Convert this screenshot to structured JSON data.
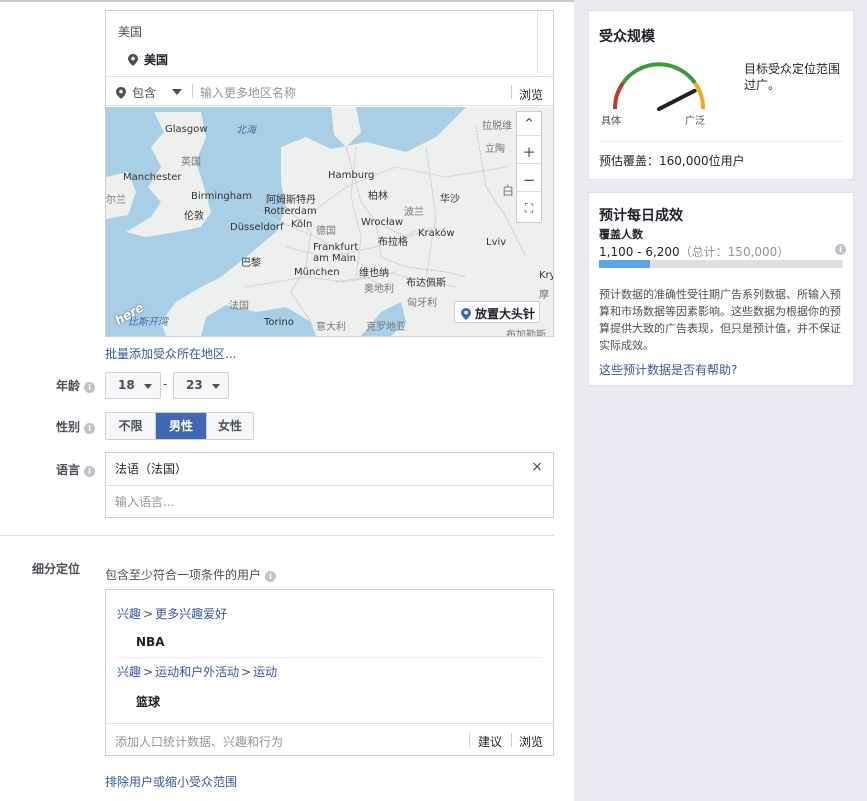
{
  "location": {
    "country_header": "美国",
    "selected": "美国",
    "include_label": "包含",
    "input_placeholder": "输入更多地区名称",
    "browse_label": "浏览",
    "drop_pin_label": "放置大头针",
    "bulk_add_link": "批量添加受众所在地区...",
    "map": {
      "provider_logo": "here",
      "labels": {
        "glasgow": "Glasgow",
        "north_sea": "北海",
        "uk": "英国",
        "manchester": "Manchester",
        "birmingham": "Birmingham",
        "london": "伦敦",
        "ireland": "尔兰",
        "amsterdam": "阿姆斯特丹",
        "rotterdam": "Rotterdam",
        "dusseldorf": "Düsseldorf",
        "koln": "Köln",
        "hamburg": "Hamburg",
        "berlin": "柏林",
        "germany": "德国",
        "frankfurt": "Frankfurt am Main",
        "paris": "巴黎",
        "munchen": "München",
        "france": "法国",
        "vienna": "维也纳",
        "wroclaw": "Wrocław",
        "poland": "波兰",
        "warsaw": "华沙",
        "prague": "布拉格",
        "krakow": "Kraków",
        "lviv": "Lviv",
        "budapest": "布达佩斯",
        "hungary": "匈牙利",
        "austria": "奥地利",
        "torino": "Torino",
        "italy": "意大利",
        "croatia": "克罗地亚",
        "bosnia": "布加勒斯",
        "biscay": "比斯开湾",
        "latvia": "拉脱维",
        "lithuania": "立陶",
        "belarus": "白",
        "kryvyi": "Kry",
        "moldova": "摩"
      }
    }
  },
  "age": {
    "label": "年龄",
    "min": "18",
    "max": "23",
    "separator": "-"
  },
  "gender": {
    "label": "性别",
    "options": [
      "不限",
      "男性",
      "女性"
    ],
    "selected": "男性"
  },
  "language": {
    "label": "语言",
    "selected_tag": "法语（法国）",
    "input_placeholder": "输入语言..."
  },
  "detailed_targeting": {
    "label": "细分定位",
    "description": "包含至少符合一项条件的用户",
    "groups": [
      {
        "path": [
          "兴趣",
          "更多兴趣爱好"
        ],
        "item": "NBA"
      },
      {
        "path": [
          "兴趣",
          "运动和户外活动",
          "运动"
        ],
        "item": "篮球"
      }
    ],
    "path_separator": ">",
    "input_placeholder": "添加人口统计数据、兴趣和行为",
    "suggest_label": "建议",
    "browse_label": "浏览",
    "exclude_link": "排除用户或缩小受众范围"
  },
  "audience_size": {
    "title": "受众规模",
    "left_label": "具体",
    "right_label": "广泛",
    "gauge_level": 0.85,
    "description": "目标受众定位范围过广。",
    "potential_reach": "预估覆盖：160,000位用户"
  },
  "daily_results": {
    "title": "预计每日成效",
    "subtitle": "覆盖人数",
    "range": "1,100 - 6,200",
    "total": "（总计：150,000）",
    "bar_fraction": 0.21,
    "note": "预计数据的准确性受往期广告系列数据、所输入预算和市场数据等因素影响。这些数据为根据你的预算提供大致的广告表现，但只是预计值，并不保证实际成效。",
    "help_link": "这些预计数据是否有帮助?"
  },
  "colors": {
    "link": "#365899",
    "selected_button": "#4267b2",
    "estimate_bar": "#5aa6e6",
    "gauge_red": "#c0392b",
    "gauge_green": "#3d9a3d",
    "gauge_orange": "#f5a623"
  }
}
